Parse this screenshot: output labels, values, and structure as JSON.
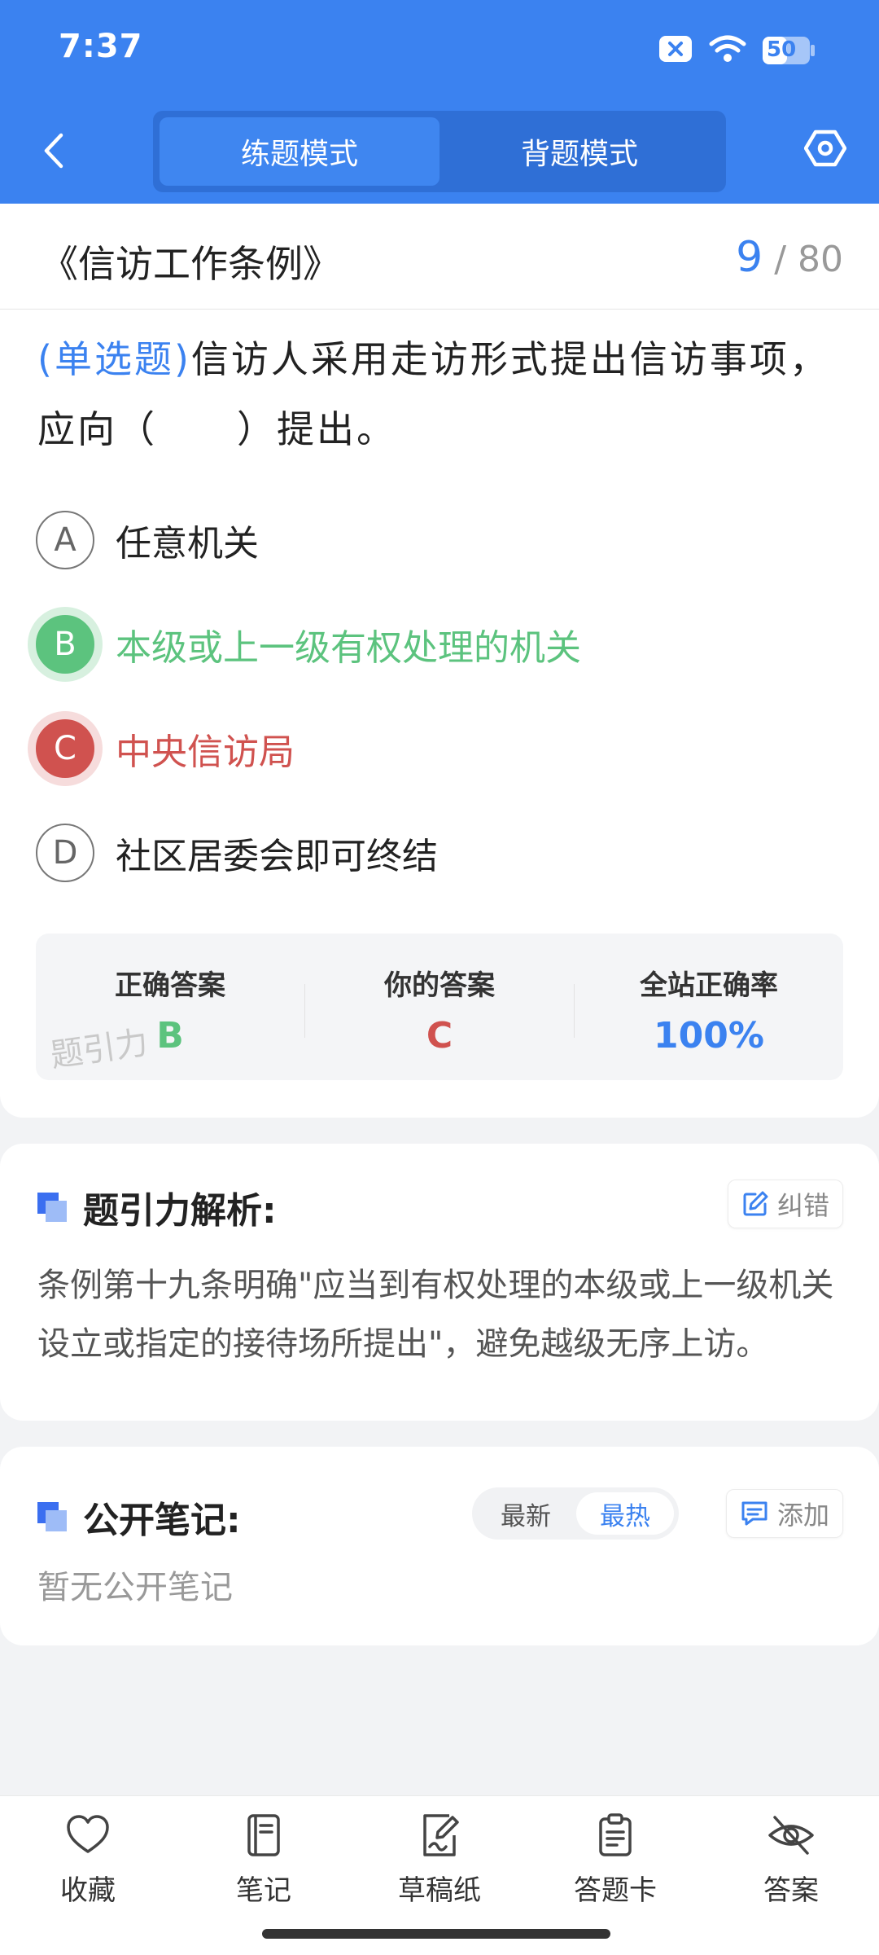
{
  "status_bar": {
    "time": "7:37",
    "battery": "50"
  },
  "header": {
    "tabs": [
      {
        "label": "练题模式",
        "active": true
      },
      {
        "label": "背题模式",
        "active": false
      }
    ]
  },
  "question": {
    "book_title": "《信访工作条例》",
    "current": "9",
    "total": "/ 80",
    "type_label": "(单选题)",
    "text": "信访人采用走访形式提出信访事项，应向（　　）提出。",
    "options": [
      {
        "letter": "A",
        "text": "任意机关",
        "state": "normal"
      },
      {
        "letter": "B",
        "text": "本级或上一级有权处理的机关",
        "state": "correct"
      },
      {
        "letter": "C",
        "text": "中央信访局",
        "state": "wrong"
      },
      {
        "letter": "D",
        "text": "社区居委会即可终结",
        "state": "normal"
      }
    ]
  },
  "stats": {
    "correct_label": "正确答案",
    "correct_value": "B",
    "yours_label": "你的答案",
    "yours_value": "C",
    "rate_label": "全站正确率",
    "rate_value": "100%",
    "watermark": "题引力",
    "colors": {
      "correct": "#5cc37e",
      "wrong": "#d0524f",
      "accent": "#3b82f0"
    }
  },
  "analysis": {
    "title": "题引力解析:",
    "report_label": "纠错",
    "text": "条例第十九条明确\"应当到有权处理的本级或上一级机关设立或指定的接待场所提出\"，避免越级无序上访。"
  },
  "notes": {
    "title": "公开笔记:",
    "sort_latest": "最新",
    "sort_hot": "最热",
    "add_label": "添加",
    "empty": "暂无公开笔记"
  },
  "bottom_nav": [
    {
      "icon": "heart-icon",
      "label": "收藏"
    },
    {
      "icon": "notebook-icon",
      "label": "笔记"
    },
    {
      "icon": "scratchpad-icon",
      "label": "草稿纸"
    },
    {
      "icon": "answer-sheet-icon",
      "label": "答题卡"
    },
    {
      "icon": "eye-off-icon",
      "label": "答案"
    }
  ]
}
